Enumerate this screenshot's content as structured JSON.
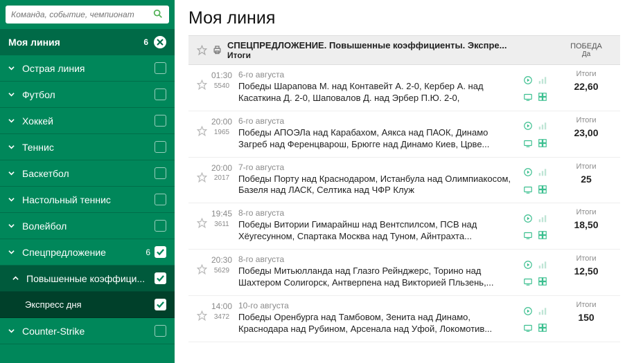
{
  "search": {
    "placeholder": "Команда, событие, чемпионат"
  },
  "my_line": {
    "title": "Моя линия",
    "count": "6"
  },
  "nav": [
    {
      "label": "Острая линия",
      "level": 0
    },
    {
      "label": "Футбол",
      "level": 0
    },
    {
      "label": "Хоккей",
      "level": 0
    },
    {
      "label": "Теннис",
      "level": 0
    },
    {
      "label": "Баскетбол",
      "level": 0
    },
    {
      "label": "Настольный теннис",
      "level": 0
    },
    {
      "label": "Волейбол",
      "level": 0
    },
    {
      "label": "Спецпредложение",
      "count": "6",
      "checked": true,
      "level": 0
    },
    {
      "label": "Повышенные коэффици...",
      "checked": true,
      "level": 1,
      "up": true
    },
    {
      "label": "Экспресс дня",
      "checked": true,
      "level": 2
    },
    {
      "label": "Counter-Strike",
      "level": 0
    }
  ],
  "page_title": "Моя линия",
  "header": {
    "title": "СПЕЦПРЕДЛОЖЕНИЕ. Повышенные коэффициенты. Экспре...",
    "sub": "Итоги",
    "col1": "ПОБЕДА",
    "col1sub": "Да"
  },
  "rows": [
    {
      "time": "01:30",
      "id": "5540",
      "date": "6-го августа",
      "descr": "Победы Шарапова М. над Контавейт А. 2-0, Кербер А. над Касаткина Д. 2-0, Шаповалов Д. над Эрбер П.Ю. 2-0,",
      "lbl": "Итоги",
      "val": "22,60"
    },
    {
      "time": "20:00",
      "id": "1965",
      "date": "6-го августа",
      "descr": "Победы АПОЭЛа над Карабахом, Аякса над ПАОК, Динамо Загреб над Ференцварош, Брюгге над Динамо Киев, Црве...",
      "lbl": "Итоги",
      "val": "23,00"
    },
    {
      "time": "20:00",
      "id": "2017",
      "date": "7-го августа",
      "descr": "Победы Порту над Краснодаром, Истанбула над Олимпиакосом, Базеля над ЛАСК, Селтика над ЧФР Клуж",
      "lbl": "Итоги",
      "val": "25"
    },
    {
      "time": "19:45",
      "id": "3611",
      "date": "8-го августа",
      "descr": "Победы Витории Гимарайнш над Вентспилсом, ПСВ над Хёугесунном, Спартака Москва над Туном, Айнтрахта...",
      "lbl": "Итоги",
      "val": "18,50"
    },
    {
      "time": "20:30",
      "id": "5629",
      "date": "8-го августа",
      "descr": "Победы Митьюлланда над Глазго Рейнджерс, Торино над Шахтером Солигорск, Антверпена над Викторией Пльзень,...",
      "lbl": "Итоги",
      "val": "12,50"
    },
    {
      "time": "14:00",
      "id": "3472",
      "date": "10-го августа",
      "descr": "Победы Оренбурга над Тамбовом, Зенита над Динамо, Краснодара над Рубином, Арсенала над Уфой, Локомотив...",
      "lbl": "Итоги",
      "val": "150"
    }
  ]
}
